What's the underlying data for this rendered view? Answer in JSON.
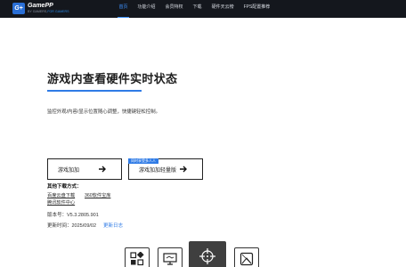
{
  "brand": {
    "mark": "G+",
    "name": "GamePP",
    "tagline_prefix": "BY GAMERS,",
    "tagline_highlight": "FOR GAMERS"
  },
  "nav": {
    "items": [
      {
        "label": "首页",
        "active": true
      },
      {
        "label": "功能介绍",
        "active": false
      },
      {
        "label": "会员特权",
        "active": false
      },
      {
        "label": "下载",
        "active": false
      },
      {
        "label": "硬件天云榜",
        "active": false
      },
      {
        "label": "FPS配置推荐",
        "active": false
      }
    ]
  },
  "hero": {
    "title": "游戏内查看硬件实时状态",
    "description": "监控外观/内容/显示位置随心调整，快捷键轻松控制。"
  },
  "buttons": {
    "download_label": "游戏加加",
    "lite_label": "游戏加加轻量版",
    "lite_badge": "同时享受多人人"
  },
  "other_downloads": {
    "title": "其他下载方式：",
    "links": [
      "百度云盘下载",
      "360软件宝库",
      "腾讯软件中心"
    ]
  },
  "meta": {
    "version": "版本号：V5.3.2805.901",
    "update_date": "更新时间：2025/09/02",
    "changelog_label": "更新日志"
  },
  "features": [
    {
      "icon": "apps-grid-icon",
      "active": false
    },
    {
      "icon": "monitor-icon",
      "active": false
    },
    {
      "icon": "crosshair-icon",
      "active": true
    },
    {
      "icon": "screenshot-icon",
      "active": false
    }
  ],
  "colors": {
    "accent": "#2f7be6",
    "nav_active": "#3d92ff",
    "topbar": "#14171d"
  }
}
